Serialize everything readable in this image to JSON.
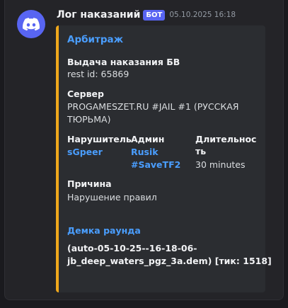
{
  "message": {
    "author": "Лог наказаний",
    "bot_badge": "БОТ",
    "timestamp": "05.10.2025 16:18",
    "avatar_icon": "discord-logo-icon",
    "avatar_color": "#5865f2"
  },
  "embed": {
    "accent_color": "#f0a81c",
    "title": "Арбитраж",
    "action": {
      "name": "Выдача наказания БВ",
      "value": "rest id: 65869"
    },
    "server": {
      "name": "Сервер",
      "value_line1": "PROGAMESZET.RU #JAIL #1 (РУССКАЯ",
      "value_line2": "ТЮРЬМА)"
    },
    "violator": {
      "name": "Нарушитель",
      "value": "sGpeer"
    },
    "admin": {
      "name": "Админ",
      "value_line1": "Rusik",
      "value_line2": "#SaveTF2"
    },
    "duration": {
      "name_line1": "Длительнос",
      "name_line2": "ть",
      "value": "30 minutes"
    },
    "reason": {
      "name": "Причина",
      "value": "Нарушение правил"
    },
    "demo": {
      "name": "Демка раунда",
      "value_line1": "(auto-05-10-25--16-18-06-",
      "value_line2": "jb_deep_waters_pgz_3a.dem) [тик: 1518]"
    }
  }
}
